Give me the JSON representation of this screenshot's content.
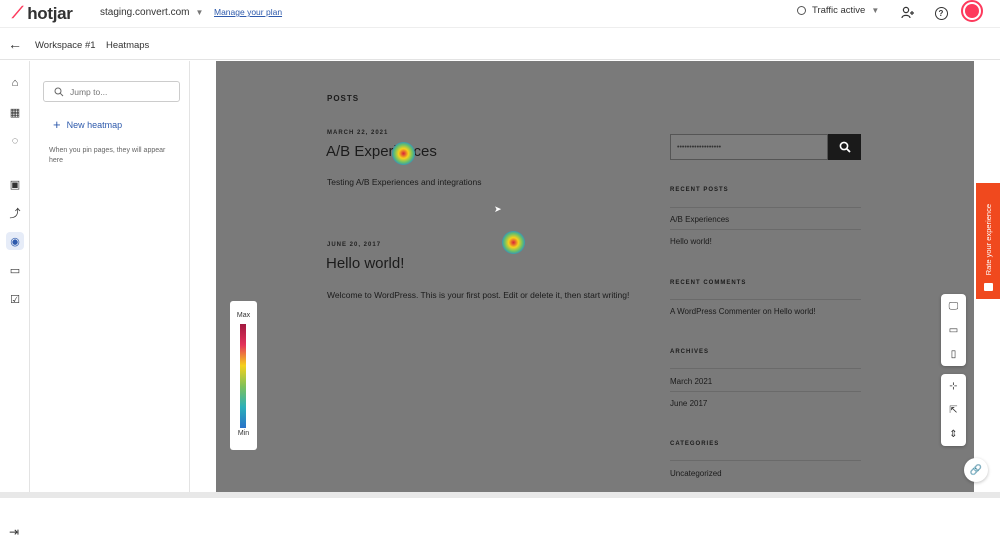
{
  "app": {
    "logo_text": "hotjar"
  },
  "top": {
    "site": "staging.convert.com",
    "manage_plan": "Manage your plan",
    "traffic_status": "Traffic active"
  },
  "breadcrumb": {
    "workspace": "Workspace #1",
    "page": "Heatmaps"
  },
  "panel": {
    "search_placeholder": "Jump to...",
    "new_heatmap": "New heatmap",
    "pin_hint": "When you pin pages, they will appear here"
  },
  "site_preview": {
    "posts_heading": "POSTS",
    "posts": [
      {
        "date": "MARCH 22, 2021",
        "title": "A/B Experiences",
        "body": "Testing A/B Experiences and integrations"
      },
      {
        "date": "JUNE 20, 2017",
        "title": "Hello world!",
        "body": "Welcome to WordPress. This is your first post. Edit or delete it, then start writing!"
      }
    ],
    "search_value": "••••••••••••••••••",
    "sidebar": {
      "recent_posts_h": "RECENT POSTS",
      "recent_posts": [
        "A/B Experiences",
        "Hello world!"
      ],
      "recent_comments_h": "RECENT COMMENTS",
      "recent_comment": "A WordPress Commenter on Hello world!",
      "archives_h": "ARCHIVES",
      "archives": [
        "March 2021",
        "June 2017"
      ],
      "categories_h": "CATEGORIES",
      "categories": [
        "Uncategorized"
      ]
    }
  },
  "legend": {
    "max": "Max",
    "min": "Min"
  },
  "feedback": {
    "label": "Rate your experience"
  },
  "colors": {
    "brand": "#fd3a5c",
    "link": "#2e5aac",
    "feedback": "#f0491e"
  }
}
